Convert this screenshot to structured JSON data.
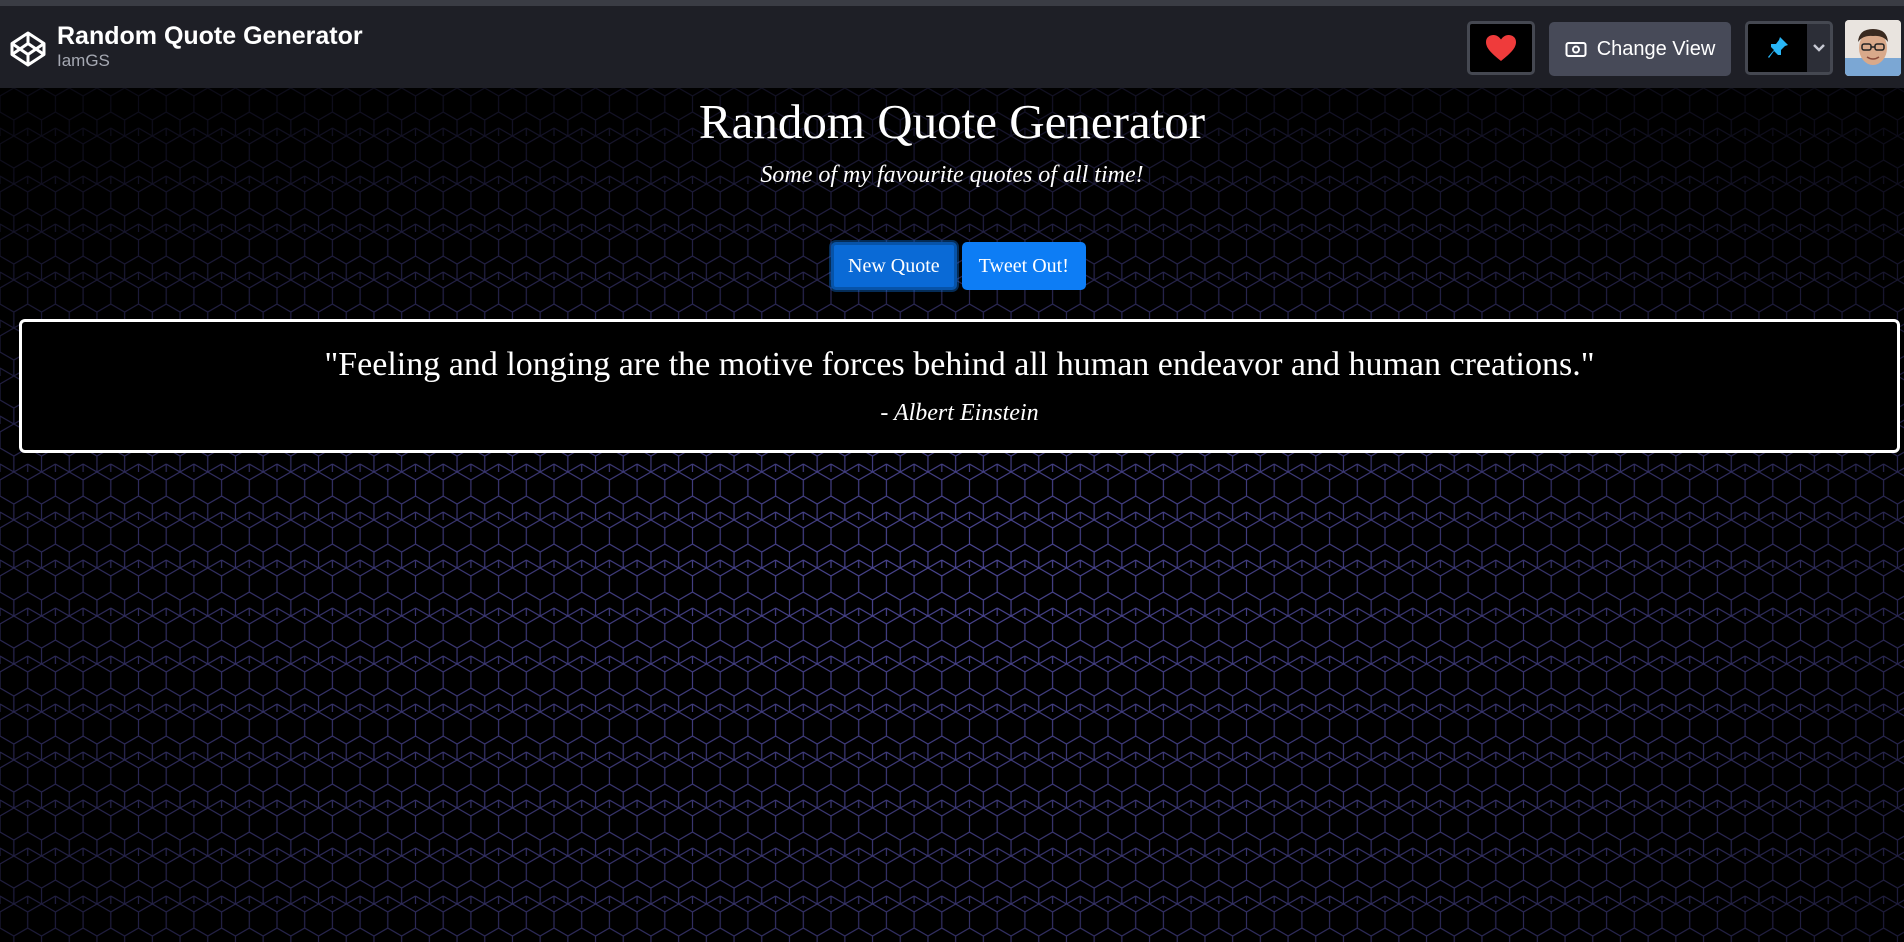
{
  "header": {
    "pen_title": "Random Quote Generator",
    "author": "IamGS",
    "change_view_label": "Change View",
    "heart_color": "#ef3b3b",
    "pin_color": "#47cf73"
  },
  "page": {
    "title": "Random Quote Generator",
    "subtitle": "Some of my favourite quotes of all time!",
    "buttons": {
      "new_quote": "New Quote",
      "tweet": "Tweet Out!"
    },
    "quote": {
      "text": "\"Feeling and longing are the motive forces behind all human endeavor and human creations.\"",
      "author": "- Albert Einstein"
    }
  },
  "colors": {
    "button_blue": "#0d7df5",
    "hex_stroke": "#5a55b8",
    "header_bg": "#1e1f26"
  }
}
